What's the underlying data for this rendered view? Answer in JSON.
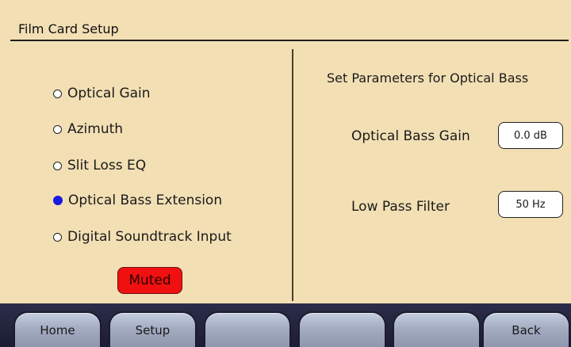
{
  "header": {
    "title": "Film Card Setup"
  },
  "options": [
    {
      "label": "Optical Gain",
      "selected": false
    },
    {
      "label": "Azimuth",
      "selected": false
    },
    {
      "label": "Slit Loss EQ",
      "selected": false
    },
    {
      "label": "Optical Bass Extension",
      "selected": true
    },
    {
      "label": "Digital Soundtrack Input",
      "selected": false
    }
  ],
  "status": {
    "muted_label": "Muted",
    "muted_color": "#f01010"
  },
  "panel": {
    "heading": "Set Parameters for Optical Bass",
    "params": [
      {
        "label": "Optical Bass Gain",
        "value": "0.0 dB"
      },
      {
        "label": "Low Pass Filter",
        "value": "50 Hz"
      }
    ]
  },
  "nav": {
    "buttons": [
      "Home",
      "Setup",
      "",
      "",
      "",
      "Back"
    ]
  },
  "colors": {
    "background": "#f2dfb4",
    "selected_radio": "#1a1ae0",
    "nav_bar": "#23243c"
  }
}
